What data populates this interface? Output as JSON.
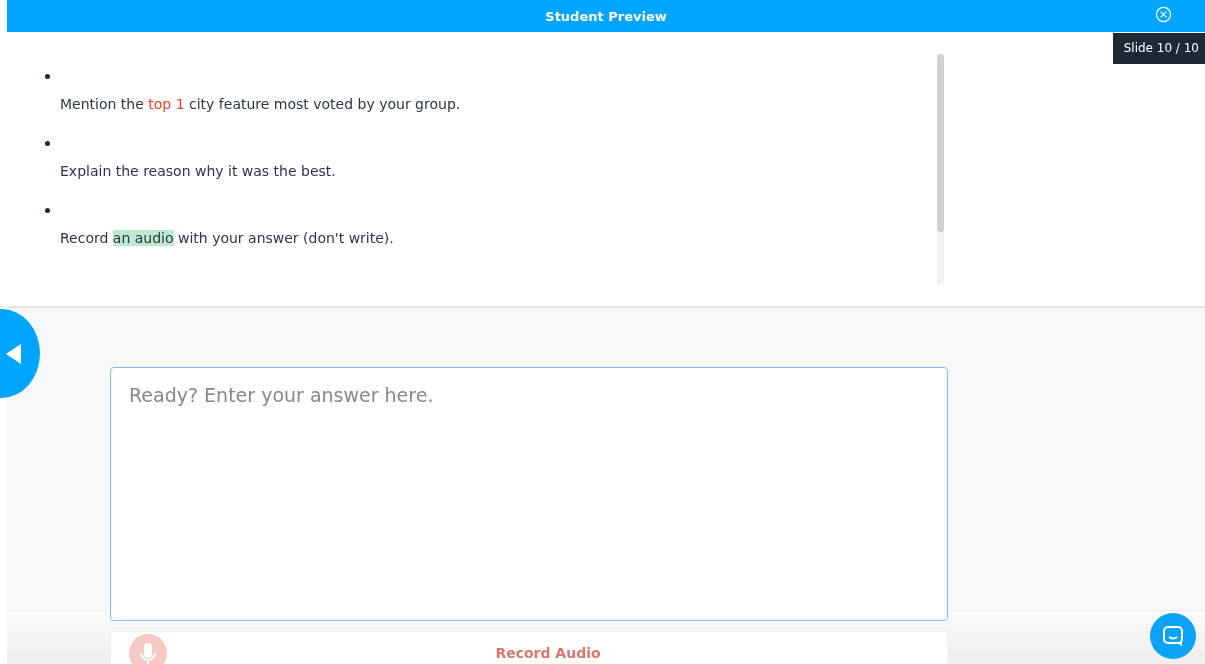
{
  "header": {
    "title": "Student Preview"
  },
  "slide_counter": "Slide 10 / 10",
  "instructions": [
    {
      "segments": [
        {
          "kind": "plain",
          "text": "Mention the "
        },
        {
          "kind": "accent",
          "text": "top 1"
        },
        {
          "kind": "plain",
          "text": " city feature most voted by your group."
        }
      ]
    },
    {
      "segments": [
        {
          "kind": "plain",
          "text": "Explain the reason why it was the best."
        }
      ]
    },
    {
      "segments": [
        {
          "kind": "plain",
          "text": "Record "
        },
        {
          "kind": "highlight",
          "text": "an audio"
        },
        {
          "kind": "plain",
          "text": " with your answer (don't write)."
        }
      ]
    }
  ],
  "answer": {
    "placeholder": "Ready? Enter your answer here."
  },
  "record_button": {
    "label": "Record Audio"
  }
}
